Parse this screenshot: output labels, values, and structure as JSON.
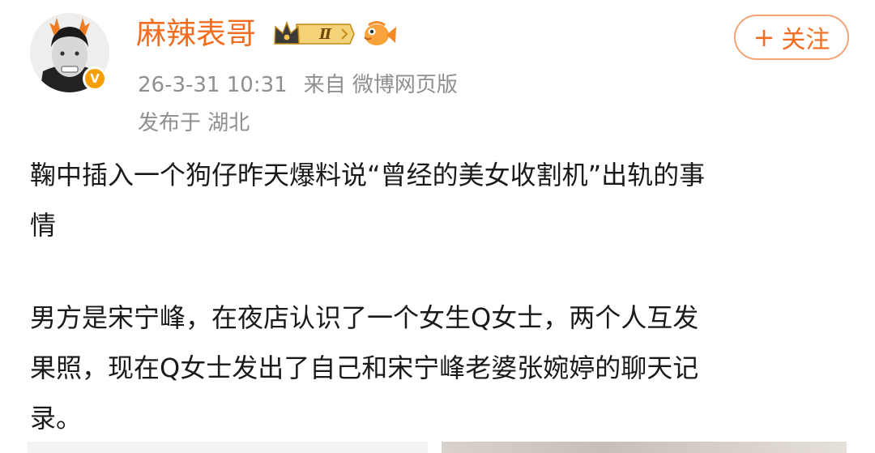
{
  "post": {
    "username": "麻辣表哥",
    "vip_level": "Ⅱ",
    "follow_label": "关注",
    "time": "26-3-31 10:31",
    "source": "来自 微博网页版",
    "location": "发布于 湖北",
    "paragraph_lines": [
      "鞠中插入一个狗仔昨天爆料说“曾经的美女收割机”出轨的事",
      "情",
      "男方是宋宁峰，在夜店认识了一个女生Q女士，两个人互发",
      "果照，现在Q女士发出了自己和宋宁峰老婆张婉婷的聊天记",
      "录。"
    ]
  },
  "colors": {
    "username": "#f26d1f",
    "follow_border": "#f3a376",
    "meta_text": "#8f8f8f",
    "verified_badge": "#f5a000"
  },
  "icons": {
    "verified": "verified-icon",
    "vip": "vip-crown-icon",
    "fan_badge": "fish-icon"
  }
}
